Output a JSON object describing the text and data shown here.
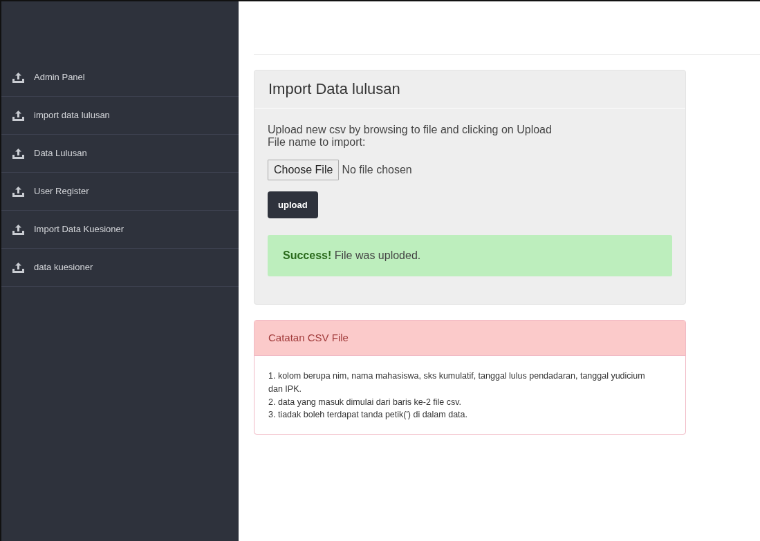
{
  "sidebar": {
    "items": [
      {
        "label": "Admin Panel"
      },
      {
        "label": "import data lulusan"
      },
      {
        "label": "Data Lulusan"
      },
      {
        "label": "User Register"
      },
      {
        "label": "Import Data Kuesioner"
      },
      {
        "label": "data kuesioner"
      }
    ]
  },
  "import_panel": {
    "title": "Import Data lulusan",
    "instructions": [
      "Upload new csv by browsing to file and clicking on Upload",
      "File name to import:"
    ],
    "file_button": "Choose File",
    "file_status": "No file chosen",
    "upload_button": "upload",
    "alert": {
      "kind": "success",
      "text": "**Success!** File was uploded."
    }
  },
  "notes_panel": {
    "title": "Catatan CSV File",
    "notes": [
      "1. kolom berupa nim, nama mahasiswa, sks kumulatif, tanggal lulus pendadaran, tanggal yudicium dan IPK.",
      "2. data yang masuk dimulai dari baris ke-2 file csv.",
      "3. tiadak boleh terdapat tanda petik(') di dalam data."
    ]
  }
}
